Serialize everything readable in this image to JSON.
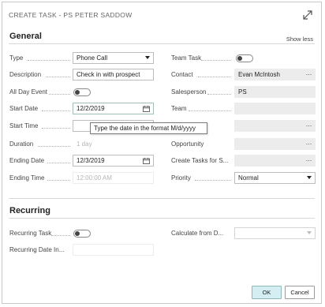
{
  "dialog": {
    "title": "CREATE TASK - PS PETER SADDOW",
    "show_less": "Show less"
  },
  "general": {
    "heading": "General",
    "left": {
      "type": {
        "label": "Type",
        "value": "Phone Call"
      },
      "description": {
        "label": "Description",
        "value": "Check in with prospect"
      },
      "all_day_event": {
        "label": "All Day Event",
        "value": false
      },
      "start_date": {
        "label": "Start Date",
        "value": "12/2/2019"
      },
      "start_time": {
        "label": "Start Time",
        "value": ""
      },
      "duration": {
        "label": "Duration",
        "value": "1 day"
      },
      "ending_date": {
        "label": "Ending Date",
        "value": "12/3/2019"
      },
      "ending_time": {
        "label": "Ending Time",
        "value": "12:00:00 AM"
      }
    },
    "right": {
      "team_task": {
        "label": "Team Task",
        "value": false
      },
      "contact": {
        "label": "Contact",
        "value": "Evan McIntosh"
      },
      "salesperson": {
        "label": "Salesperson",
        "value": "PS"
      },
      "team": {
        "label": "Team",
        "value": ""
      },
      "unlabeled": {
        "label": "",
        "value": ""
      },
      "opportunity": {
        "label": "Opportunity",
        "value": ""
      },
      "create_tasks_for": {
        "label": "Create Tasks for S...",
        "value": ""
      },
      "priority": {
        "label": "Priority",
        "value": "Normal"
      }
    },
    "tooltip": "Type the date in the format M/d/yyyy"
  },
  "recurring": {
    "heading": "Recurring",
    "recurring_task": {
      "label": "Recurring Task",
      "value": false
    },
    "recurring_date_interval": {
      "label": "Recurring Date In...",
      "value": ""
    },
    "calculate_from_date": {
      "label": "Calculate from D...",
      "value": ""
    }
  },
  "footer": {
    "ok": "OK",
    "cancel": "Cancel"
  },
  "icons": [
    "expand-icon",
    "dropdown-caret-icon",
    "calendar-icon",
    "ellipsis-icon",
    "toggle-switch"
  ],
  "colors": {
    "ok_button": "#d5eef1",
    "ok_border": "#8fb8bd",
    "readonly_field": "#ececec"
  }
}
